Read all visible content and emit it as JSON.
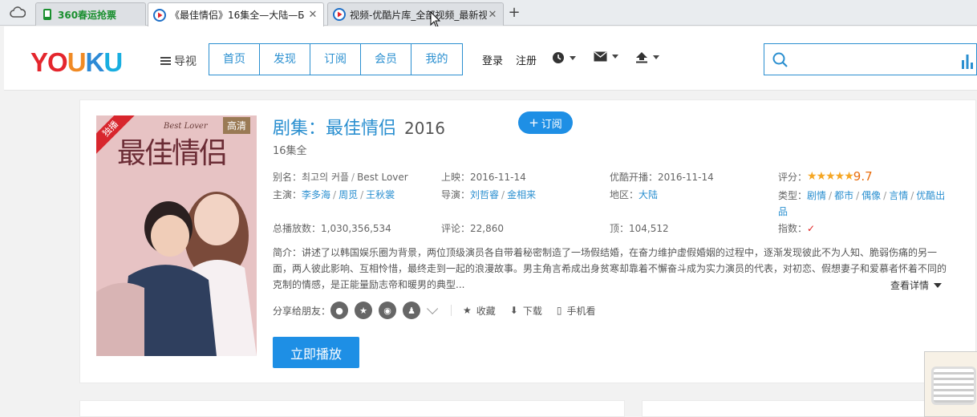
{
  "browser": {
    "tabs": [
      {
        "title": "360春运抢票"
      },
      {
        "title": "《最佳情侣》16集全—大陆—Б"
      },
      {
        "title": "视频-优酷片库_全部视频_最新视"
      }
    ],
    "new_tab_label": "+"
  },
  "header": {
    "logo": {
      "y": "YO",
      "u": "U",
      "k": "K",
      "u2": "U"
    },
    "guide_label": "导视",
    "nav": [
      "首页",
      "发现",
      "订阅",
      "会员",
      "我的"
    ],
    "login": "登录",
    "register": "注册",
    "search": {
      "value": "",
      "placeholder": ""
    }
  },
  "show": {
    "category": "剧集：最佳情侣",
    "year": "2016",
    "subscribe_label": "订阅",
    "episodes": "16集全",
    "poster": {
      "badge_hd": "高清",
      "badge_exclusive": "独播",
      "title_art": "最佳情侣",
      "subtitle_art": "Best Lover"
    },
    "alias_label": "别名：",
    "alias_value": "최고의 커플",
    "alias_sep": "/",
    "alias_en": "Best Lover",
    "release_label": "上映：",
    "release_value": "2016-11-14",
    "youku_label": "优酷开播：",
    "youku_value": "2016-11-14",
    "score_label": "评分：",
    "score_value": "9.7",
    "stars_count": 5,
    "cast_label": "主演：",
    "cast": [
      "李多海",
      "周觅",
      "王秋裳"
    ],
    "director_label": "导演：",
    "directors": [
      "刘哲睿",
      "金相来"
    ],
    "region_label": "地区：",
    "region": "大陆",
    "genre_label": "类型：",
    "genres": [
      "剧情",
      "都市",
      "偶像",
      "言情",
      "优酷出品"
    ],
    "plays_label": "总播放数：",
    "plays_value": "1,030,356,534",
    "comments_label": "评论：",
    "comments_value": "22,860",
    "likes_label": "顶：",
    "likes_value": "104,512",
    "index_label": "指数：",
    "description": "简介：讲述了以韩国娱乐圈为背景，两位顶级演员各自带着秘密制造了一场假结婚，在奋力维护虚假婚姻的过程中，逐渐发现彼此不为人知、脆弱伤痛的另一面，两人彼此影响、互相怜惜，最终走到一起的浪漫故事。男主角言希成出身贫寒却靠着不懈奋斗成为实力演员的代表，对初恋、假想妻子和爱慕者怀着不同的克制的情感，是正能量励志帝和暖男的典型...",
    "more_label": "查看详情",
    "share_label": "分享给朋友：",
    "favorite_label": "收藏",
    "download_label": "下载",
    "mobile_label": "手机看",
    "play_label": "立即播放"
  },
  "colors": {
    "accent": "#2a8fd0",
    "button": "#1e8fe5",
    "rating": "#e96e0e"
  }
}
